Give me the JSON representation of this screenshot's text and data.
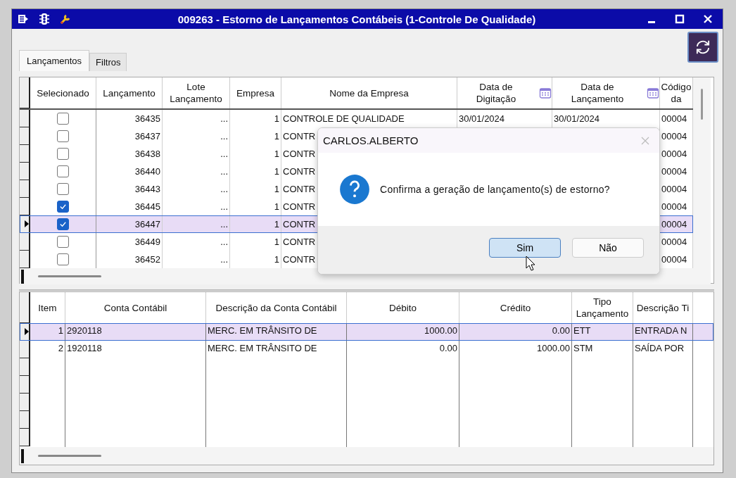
{
  "window": {
    "title": "009263 - Estorno de Lançamentos Contábeis (1-Controle De Qualidade)"
  },
  "tabs": [
    {
      "label": "Lançamentos",
      "selected": true
    },
    {
      "label": "Filtros",
      "selected": false
    }
  ],
  "top_grid": {
    "columns": [
      {
        "label": "Selecionado",
        "kind": "check"
      },
      {
        "label": "Lançamento",
        "kind": "text"
      },
      {
        "label": "Lote Lançamento",
        "kind": "text"
      },
      {
        "label": "Empresa",
        "kind": "text"
      },
      {
        "label": "Nome da Empresa",
        "kind": "text"
      },
      {
        "label": "Data de Digitação",
        "kind": "date"
      },
      {
        "label": "Data de Lançamento",
        "kind": "date"
      },
      {
        "label": "Código da",
        "kind": "text"
      }
    ],
    "rows": [
      {
        "selected": false,
        "checked": false,
        "cells": [
          "",
          "36435",
          "...",
          "1",
          "CONTROLE DE QUALIDADE",
          "30/01/2024",
          "30/01/2024",
          "00004"
        ]
      },
      {
        "selected": false,
        "checked": false,
        "cells": [
          "",
          "36437",
          "...",
          "1",
          "CONTR",
          "",
          "",
          "00004"
        ]
      },
      {
        "selected": false,
        "checked": false,
        "cells": [
          "",
          "36438",
          "...",
          "1",
          "CONTR",
          "",
          "",
          "00004"
        ]
      },
      {
        "selected": false,
        "checked": false,
        "cells": [
          "",
          "36440",
          "...",
          "1",
          "CONTR",
          "",
          "",
          "00004"
        ]
      },
      {
        "selected": false,
        "checked": false,
        "cells": [
          "",
          "36443",
          "...",
          "1",
          "CONTR",
          "",
          "",
          "00004"
        ]
      },
      {
        "selected": false,
        "checked": true,
        "cells": [
          "",
          "36445",
          "...",
          "1",
          "CONTR",
          "",
          "",
          "00004"
        ]
      },
      {
        "selected": true,
        "checked": true,
        "cells": [
          "",
          "36447",
          "...",
          "1",
          "CONTR",
          "",
          "",
          "00004"
        ]
      },
      {
        "selected": false,
        "checked": false,
        "cells": [
          "",
          "36449",
          "...",
          "1",
          "CONTR",
          "",
          "",
          "00004"
        ]
      },
      {
        "selected": false,
        "checked": false,
        "cells": [
          "",
          "36452",
          "...",
          "1",
          "CONTR",
          "",
          "",
          "00004"
        ]
      }
    ]
  },
  "bottom_grid": {
    "columns": [
      "Item",
      "Conta Contábil",
      "Descrição da Conta Contábil",
      "Débito",
      "Crédito",
      "Tipo Lançamento",
      "Descrição Ti"
    ],
    "rows": [
      {
        "selected": true,
        "cells": [
          "1",
          "2920118",
          "MERC. EM TRÂNSITO DE",
          "1000.00",
          "0.00",
          "ETT",
          "ENTRADA N"
        ]
      },
      {
        "selected": false,
        "cells": [
          "2",
          "1920118",
          "MERC. EM TRÂNSITO DE",
          "0.00",
          "1000.00",
          "STM",
          "SAÍDA POR"
        ]
      }
    ]
  },
  "dialog": {
    "title": "CARLOS.ALBERTO",
    "message": "Confirma a geração de lançamento(s) de estorno?",
    "buttons": [
      {
        "label": "Sim",
        "selected": true
      },
      {
        "label": "Não",
        "selected": false
      }
    ]
  }
}
